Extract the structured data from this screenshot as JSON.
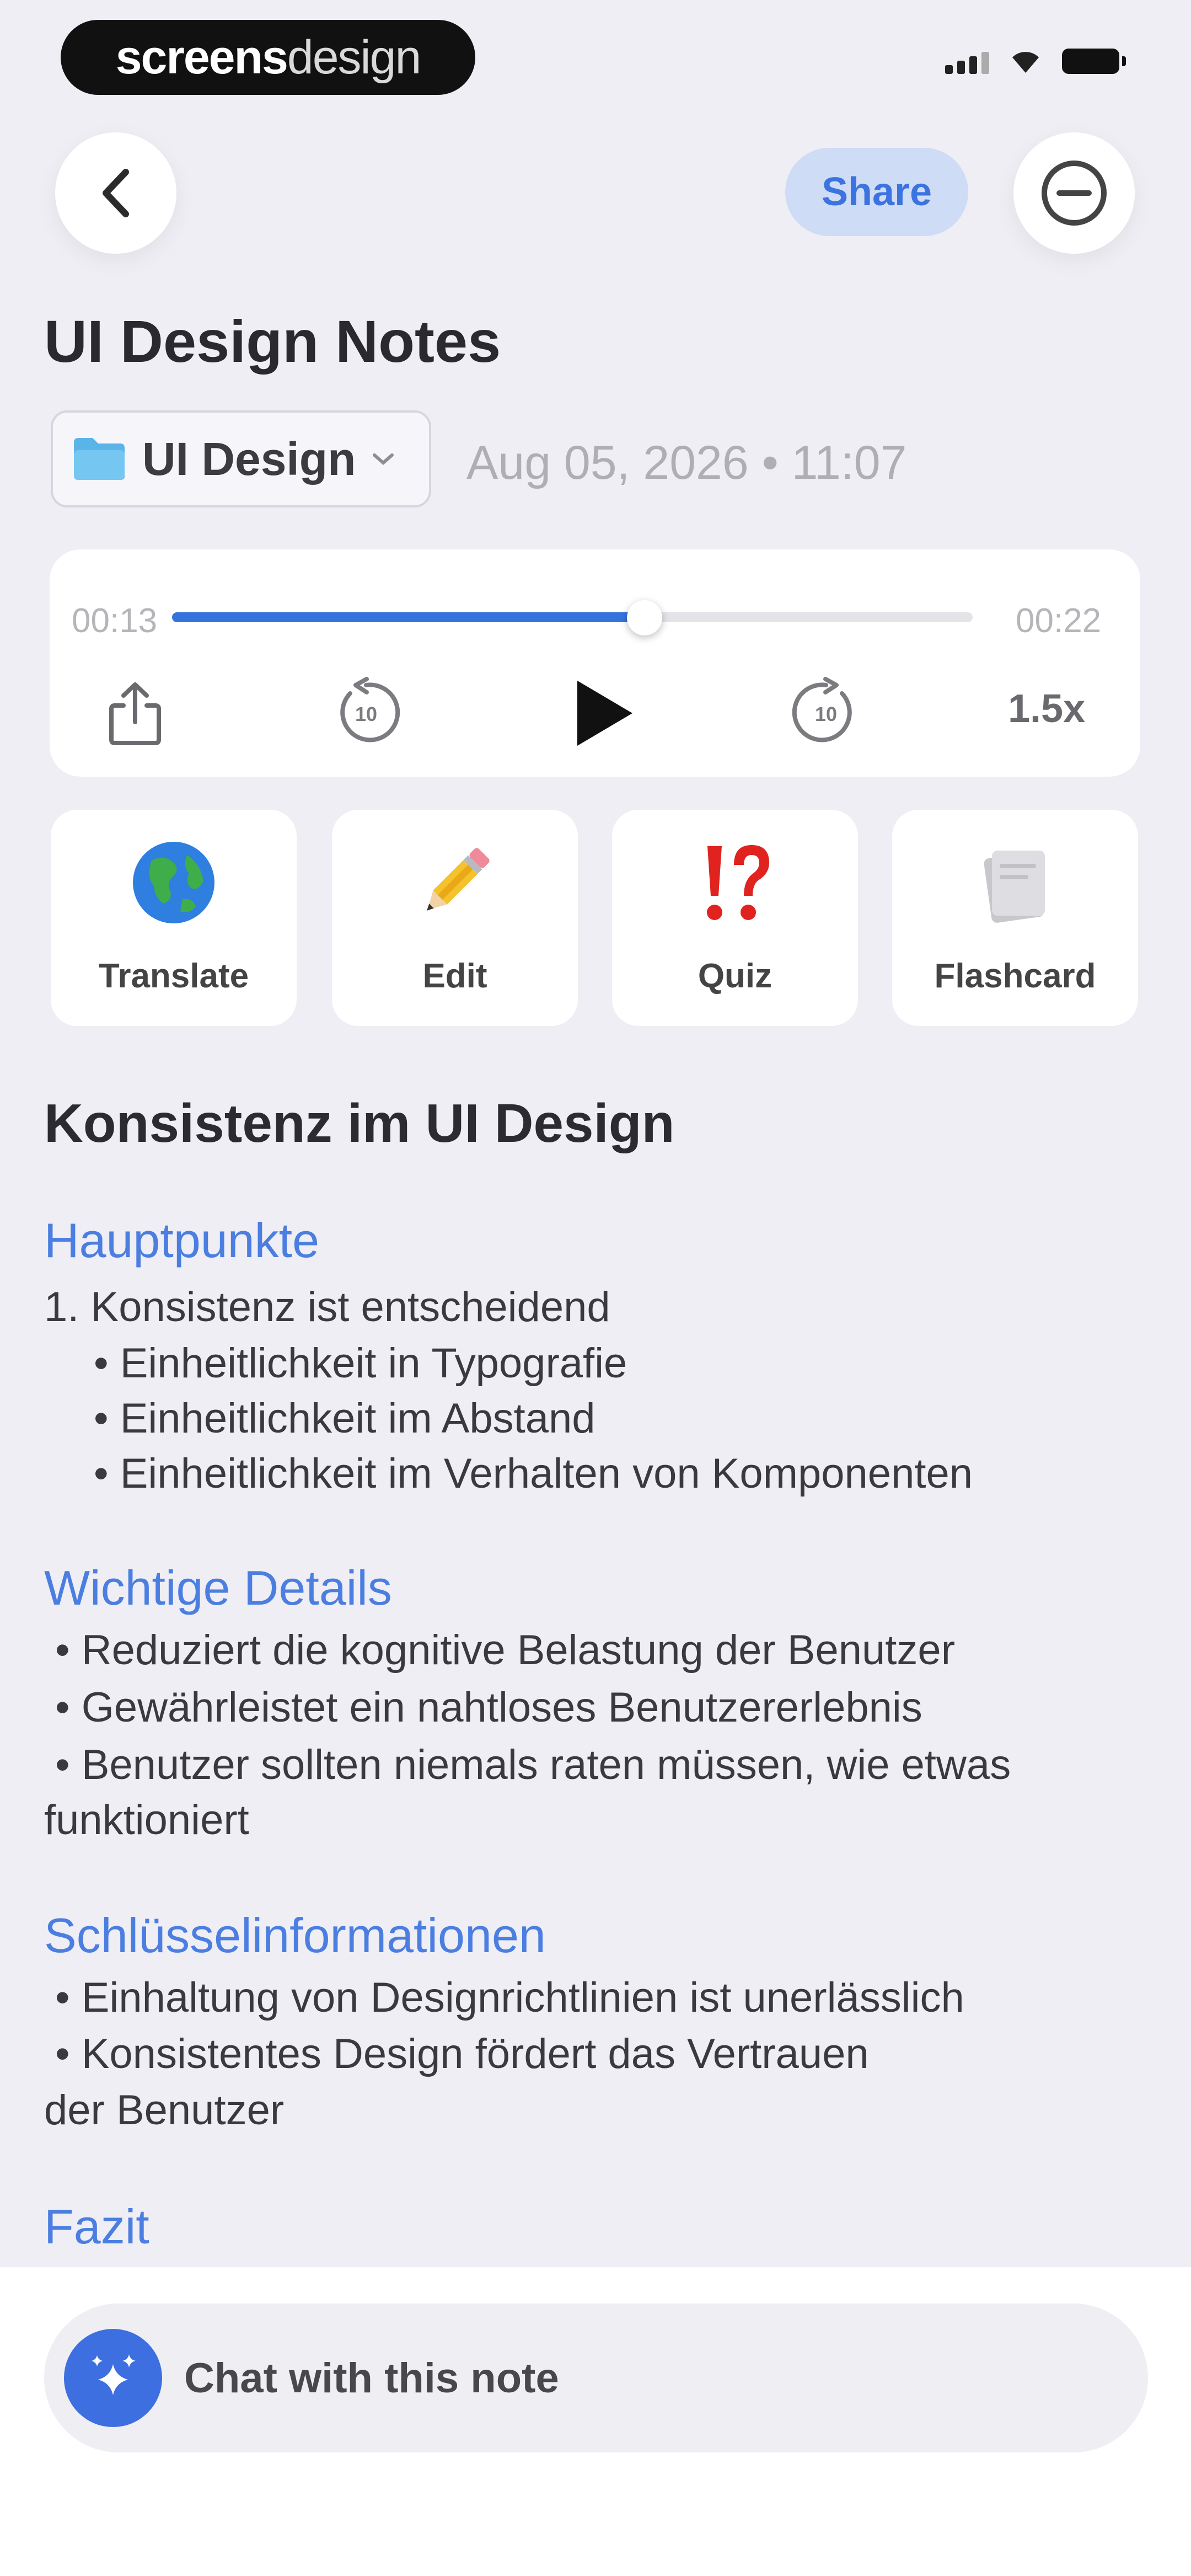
{
  "status_bar": {
    "brand_part1": "screens",
    "brand_part2": "design"
  },
  "header": {
    "back_icon": "chevron-left-icon",
    "share_label": "Share",
    "more_icon": "minus-circle-icon"
  },
  "note": {
    "title": "UI Design Notes",
    "folder_label": "UI Design",
    "date": "Aug 05, 2026 • 11:07"
  },
  "player": {
    "elapsed": "00:13",
    "total": "00:22",
    "progress": 0.59,
    "speed": "1.5x",
    "skip_back_label": "10",
    "skip_forward_label": "10",
    "accent_color": "#3573dc"
  },
  "actions": [
    {
      "label": "Translate",
      "icon": "globe-icon"
    },
    {
      "label": "Edit",
      "icon": "pencil-icon"
    },
    {
      "label": "Quiz",
      "icon": "exclamation-question-icon"
    },
    {
      "label": "Flashcard",
      "icon": "cards-icon"
    }
  ],
  "content": {
    "heading": "Konsistenz im UI Design",
    "sections": [
      {
        "title": "Hauptpunkte",
        "lines": [
          "1. Konsistenz ist entscheidend",
          "• Einheitlichkeit in Typografie",
          "• Einheitlichkeit im Abstand",
          "• Einheitlichkeit im Verhalten von Komponenten"
        ]
      },
      {
        "title": "Wichtige Details",
        "lines": [
          "• Reduziert die kognitive Belastung der Benutzer",
          "• Gewährleistet ein nahtloses Benutzererlebnis",
          "• Benutzer sollten niemals raten müssen, wie etwas",
          "funktioniert"
        ]
      },
      {
        "title": "Schlüsselinformationen",
        "lines": [
          "• Einhaltung von Designrichtlinien ist unerlässlich",
          "• Konsistentes Design fördert das Vertrauen",
          "der Benutzer"
        ]
      },
      {
        "title": "Fazit",
        "lines": []
      }
    ]
  },
  "chat": {
    "label": "Chat with this note",
    "icon": "sparkles-icon"
  }
}
